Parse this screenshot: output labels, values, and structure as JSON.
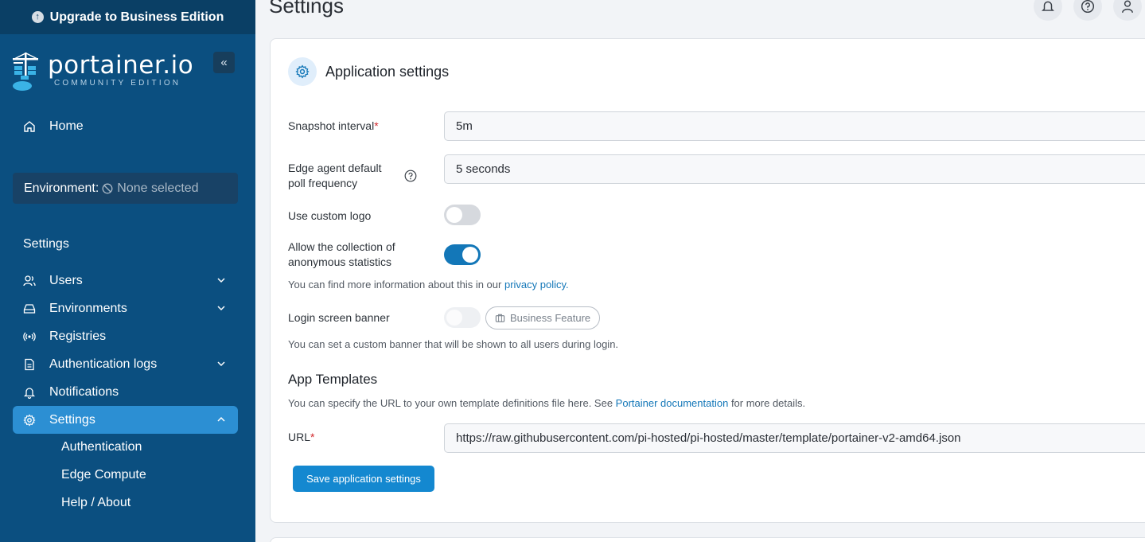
{
  "sidebar": {
    "upgrade_label": "Upgrade to Business Edition",
    "logo_main": "portainer.io",
    "logo_sub": "COMMUNITY EDITION",
    "collapse_glyph": "«",
    "home_label": "Home",
    "environment_label": "Environment:",
    "environment_value": "None selected",
    "section_title": "Settings",
    "items": [
      {
        "label": "Users",
        "icon": "users-icon",
        "expandable": true
      },
      {
        "label": "Environments",
        "icon": "hdd-icon",
        "expandable": true
      },
      {
        "label": "Registries",
        "icon": "radio-icon",
        "expandable": false
      },
      {
        "label": "Authentication logs",
        "icon": "file-text-icon",
        "expandable": true
      },
      {
        "label": "Notifications",
        "icon": "bell-icon",
        "expandable": false
      },
      {
        "label": "Settings",
        "icon": "gear-icon",
        "expandable": true,
        "active": true
      }
    ],
    "sub_items": [
      "Authentication",
      "Edge Compute",
      "Help / About"
    ]
  },
  "header": {
    "title": "Settings"
  },
  "card": {
    "title": "Application settings",
    "snapshot_label": "Snapshot interval",
    "snapshot_required": "*",
    "snapshot_value": "5m",
    "poll_label_line1": "Edge agent default",
    "poll_label_line2": "poll frequency",
    "poll_value": "5 seconds",
    "custom_logo_label": "Use custom logo",
    "custom_logo_enabled": false,
    "stats_label_line1": "Allow the collection of",
    "stats_label_line2": "anonymous statistics",
    "stats_enabled": true,
    "stats_help_prefix": "You can find more information about this in our ",
    "stats_help_link": "privacy policy.",
    "banner_label": "Login screen banner",
    "banner_badge": "Business Feature",
    "banner_help": "You can set a custom banner that will be shown to all users during login.",
    "templates_heading": "App Templates",
    "templates_help_prefix": "You can specify the URL to your own template definitions file here. See ",
    "templates_help_link": "Portainer documentation",
    "templates_help_suffix": " for more details.",
    "url_label": "URL",
    "url_required": "*",
    "url_value": "https://raw.githubusercontent.com/pi-hosted/pi-hosted/master/template/portainer-v2-amd64.json",
    "save_label": "Save application settings"
  },
  "colors": {
    "sidebar_bg": "#0b4f80",
    "accent": "#1488d0",
    "active_item": "#2c8fd3"
  }
}
